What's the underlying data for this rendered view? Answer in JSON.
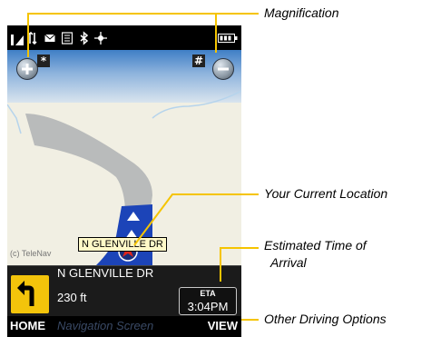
{
  "callouts": {
    "magnification": "Magnification",
    "current_location": "Your Current Location",
    "eta_line1": "Estimated Time of",
    "eta_line2": "Arrival",
    "driving_options": "Other Driving Options"
  },
  "status_icons": [
    "signal-icon",
    "data-icon",
    "message-icon",
    "voicemail-icon",
    "bluetooth-icon",
    "gps-icon",
    "battery-icon"
  ],
  "map": {
    "zoom_in_key": "*",
    "zoom_out_key": "#",
    "street_label": "N GLENVILLE DR",
    "copyright": "(c) TeleNav"
  },
  "navigation": {
    "next_street": "N GLENVILLE DR",
    "distance": "230 ft",
    "turn_icon": "turn-left-icon",
    "eta_label": "ETA",
    "eta_time": "3:04PM"
  },
  "softkeys": {
    "left": "HOME",
    "center": "Navigation Screen",
    "right": "VIEW"
  },
  "colors": {
    "route": "#1c44b8",
    "road": "#b9bbbb",
    "turn_icon_bg": "#f3c40b",
    "map_bg": "#f1efe3",
    "street_label_bg": "#fff9c8"
  }
}
